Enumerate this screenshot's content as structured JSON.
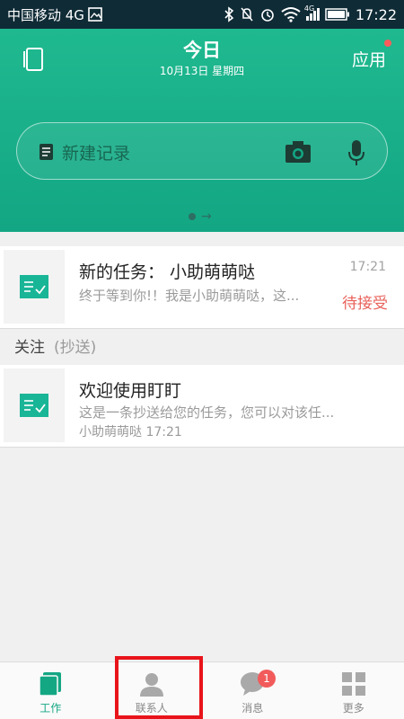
{
  "status_bar": {
    "carrier": "中国移动 4G",
    "time": "17:22",
    "network_badge": "4G"
  },
  "header": {
    "title": "今日",
    "date": "10月13日 星期四",
    "apps_label": "应用"
  },
  "search": {
    "placeholder": "新建记录"
  },
  "tasks": [
    {
      "title": "新的任务：  小助萌萌哒",
      "description": "终于等到你!！我是小助萌萌哒，这...",
      "time": "17:21",
      "status": "待接受"
    }
  ],
  "follow_section": {
    "label": "关注",
    "sub_label": "(抄送)"
  },
  "followed": [
    {
      "title": "欢迎使用盯盯",
      "description": "这是一条抄送给您的任务，您可以对该任...",
      "meta": "小助萌萌哒 17:21"
    }
  ],
  "tabs": [
    {
      "label": "工作",
      "active": true
    },
    {
      "label": "联系人",
      "active": false
    },
    {
      "label": "消息",
      "active": false,
      "badge": "1"
    },
    {
      "label": "更多",
      "active": false
    }
  ],
  "colors": {
    "accent": "#14a784",
    "alert": "#e8615a",
    "highlight": "#e8141a"
  }
}
